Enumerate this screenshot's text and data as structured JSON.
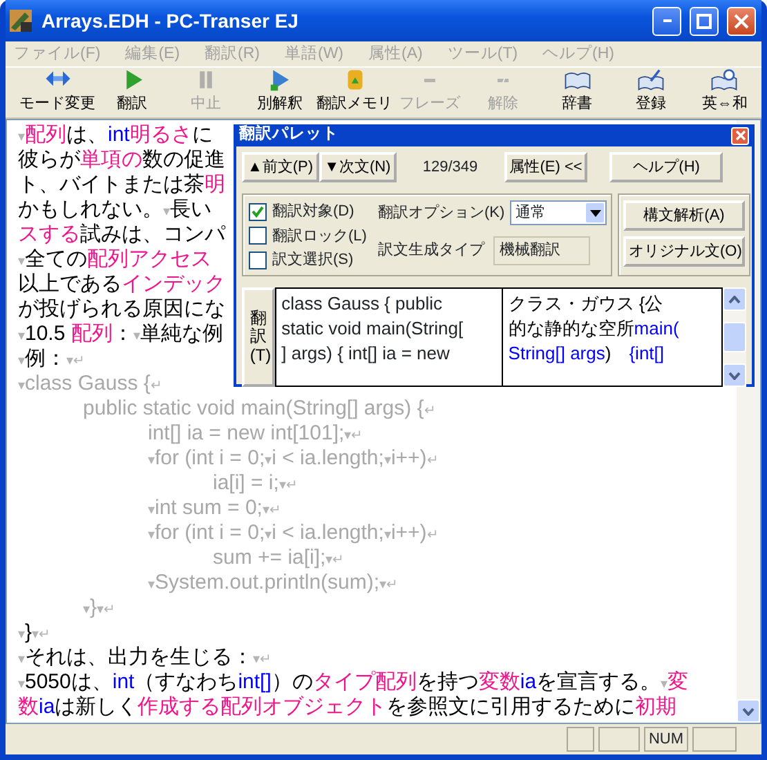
{
  "window": {
    "title": "Arrays.EDH - PC-Transer EJ"
  },
  "menu": [
    "ファイル(F)",
    "編集(E)",
    "翻訳(R)",
    "単語(W)",
    "属性(A)",
    "ツール(T)",
    "ヘルプ(H)"
  ],
  "toolbar": [
    {
      "label": "モード変更",
      "disabled": false
    },
    {
      "label": "翻訳",
      "disabled": false
    },
    {
      "label": "中止",
      "disabled": true
    },
    {
      "label": "別解釈",
      "disabled": false
    },
    {
      "label": "翻訳メモリ",
      "disabled": false
    },
    {
      "label": "フレーズ",
      "disabled": true
    },
    {
      "label": "解除",
      "disabled": true
    },
    {
      "label": "辞書",
      "disabled": false
    },
    {
      "label": "登録",
      "disabled": false
    },
    {
      "label": "英⇔和",
      "disabled": false
    }
  ],
  "document": [
    [
      {
        "kind": "mark",
        "text": "▾"
      },
      {
        "kind": "term",
        "text": "配列"
      },
      {
        "kind": "plain",
        "text": "は、"
      },
      {
        "kind": "keyword",
        "text": "int"
      },
      {
        "kind": "term",
        "text": "明るさ"
      },
      {
        "kind": "plain",
        "text": "に"
      }
    ],
    [
      {
        "kind": "plain",
        "text": "彼らが"
      },
      {
        "kind": "term",
        "text": "単項の"
      },
      {
        "kind": "plain",
        "text": "数の促進"
      }
    ],
    [
      {
        "kind": "plain",
        "text": "ト、バイトまたは茶"
      },
      {
        "kind": "term",
        "text": "明"
      }
    ],
    [
      {
        "kind": "plain",
        "text": "かもしれない。"
      },
      {
        "kind": "mark",
        "text": "▾"
      },
      {
        "kind": "plain",
        "text": "長い"
      }
    ],
    [
      {
        "kind": "term",
        "text": "スする"
      },
      {
        "kind": "plain",
        "text": "試みは、コンパ"
      }
    ],
    [
      {
        "kind": "mark",
        "text": "▾"
      },
      {
        "kind": "plain",
        "text": "全ての"
      },
      {
        "kind": "term",
        "text": "配列アクセス"
      }
    ],
    [
      {
        "kind": "plain",
        "text": "以上である"
      },
      {
        "kind": "term",
        "text": "インデック"
      }
    ],
    [
      {
        "kind": "plain",
        "text": "が投げられる原因にな"
      }
    ],
    [
      {
        "kind": "mark",
        "text": "▾"
      },
      {
        "kind": "plain",
        "text": "10.5 "
      },
      {
        "kind": "term",
        "text": "配列"
      },
      {
        "kind": "plain",
        "text": "："
      },
      {
        "kind": "mark",
        "text": "▾"
      },
      {
        "kind": "plain",
        "text": "単純な例"
      }
    ],
    [
      {
        "kind": "mark",
        "text": "▾"
      },
      {
        "kind": "plain",
        "text": "例："
      },
      {
        "kind": "mark",
        "text": "▾↵"
      }
    ],
    [
      {
        "kind": "mark",
        "text": "▾"
      },
      {
        "kind": "code",
        "text": "class Gauss {"
      },
      {
        "kind": "mark",
        "text": "↵"
      }
    ],
    [
      {
        "kind": "code",
        "text": "\tpublic static void main(String[] args) {"
      },
      {
        "kind": "mark",
        "text": "↵"
      }
    ],
    [
      {
        "kind": "code",
        "text": "\t\tint[] ia = new int[101];"
      },
      {
        "kind": "mark",
        "text": "▾↵"
      }
    ],
    [
      {
        "kind": "mark",
        "text": "\t\t▾"
      },
      {
        "kind": "code",
        "text": "for (int i = 0;"
      },
      {
        "kind": "mark",
        "text": "▾"
      },
      {
        "kind": "code",
        "text": "i < ia.length;"
      },
      {
        "kind": "mark",
        "text": "▾"
      },
      {
        "kind": "code",
        "text": "i++)"
      },
      {
        "kind": "mark",
        "text": "↵"
      }
    ],
    [
      {
        "kind": "code",
        "text": "\t\t\tia[i] = i;"
      },
      {
        "kind": "mark",
        "text": "▾↵"
      }
    ],
    [
      {
        "kind": "mark",
        "text": "\t\t▾"
      },
      {
        "kind": "code",
        "text": "int sum = 0;"
      },
      {
        "kind": "mark",
        "text": "▾↵"
      }
    ],
    [
      {
        "kind": "mark",
        "text": "\t\t▾"
      },
      {
        "kind": "code",
        "text": "for (int i = 0;"
      },
      {
        "kind": "mark",
        "text": "▾"
      },
      {
        "kind": "code",
        "text": "i < ia.length;"
      },
      {
        "kind": "mark",
        "text": "▾"
      },
      {
        "kind": "code",
        "text": "i++)"
      },
      {
        "kind": "mark",
        "text": "↵"
      }
    ],
    [
      {
        "kind": "code",
        "text": "\t\t\tsum += ia[i];"
      },
      {
        "kind": "mark",
        "text": "▾↵"
      }
    ],
    [
      {
        "kind": "mark",
        "text": "\t\t▾"
      },
      {
        "kind": "code",
        "text": "System.out.println(sum);"
      },
      {
        "kind": "mark",
        "text": "▾↵"
      }
    ],
    [
      {
        "kind": "mark",
        "text": "\t▾"
      },
      {
        "kind": "code",
        "text": "}"
      },
      {
        "kind": "mark",
        "text": "▾↵"
      }
    ],
    [
      {
        "kind": "mark",
        "text": "▾"
      },
      {
        "kind": "plain",
        "text": "}"
      },
      {
        "kind": "mark",
        "text": "▾↵"
      }
    ],
    [
      {
        "kind": "mark",
        "text": "▾"
      },
      {
        "kind": "plain",
        "text": "それは、出力を生じる："
      },
      {
        "kind": "mark",
        "text": "▾↵"
      }
    ],
    [
      {
        "kind": "mark",
        "text": "▾"
      },
      {
        "kind": "plain",
        "text": "5050は、"
      },
      {
        "kind": "keyword",
        "text": "int"
      },
      {
        "kind": "plain",
        "text": "（すなわち"
      },
      {
        "kind": "keyword",
        "text": "int[]"
      },
      {
        "kind": "plain",
        "text": "）の"
      },
      {
        "kind": "term",
        "text": "タイプ配列"
      },
      {
        "kind": "plain",
        "text": "を持つ"
      },
      {
        "kind": "term",
        "text": "変数"
      },
      {
        "kind": "keyword",
        "text": "ia"
      },
      {
        "kind": "plain",
        "text": "を宣言する。"
      },
      {
        "kind": "mark",
        "text": "▾"
      },
      {
        "kind": "term",
        "text": "変"
      }
    ],
    [
      {
        "kind": "term",
        "text": "数"
      },
      {
        "kind": "keyword",
        "text": "ia"
      },
      {
        "kind": "plain",
        "text": "は新しく"
      },
      {
        "kind": "term",
        "text": "作成する配列オブジェクト"
      },
      {
        "kind": "plain",
        "text": "を参照文に引用するために"
      },
      {
        "kind": "term",
        "text": "初期"
      }
    ]
  ],
  "palette": {
    "title": "翻訳パレット",
    "prev": "▲前文(P)",
    "next": "▼次文(N)",
    "counter": "129/349",
    "attributes": "属性(E) <<",
    "help": "ヘルプ(H)",
    "checks": [
      {
        "label": "翻訳対象(D)",
        "checked": true
      },
      {
        "label": "翻訳ロック(L)",
        "checked": false
      },
      {
        "label": "訳文選択(S)",
        "checked": false
      }
    ],
    "option_label": "翻訳オプション(K)",
    "option_value": "通常",
    "type_label": "訳文生成タイプ",
    "type_value": "機械翻訳",
    "parse": "構文解析(A)",
    "original": "オリジナル文(O)",
    "translate": "翻訳(T)",
    "source": [
      "class Gauss { public",
      "static void main(String[",
      "] args) { int[] ia = new"
    ],
    "target": [
      [
        {
          "kind": "plain",
          "text": "クラス・ガウス {公"
        }
      ],
      [
        {
          "kind": "plain",
          "text": "的な静的な空所"
        },
        {
          "kind": "keyword",
          "text": "main("
        }
      ],
      [
        {
          "kind": "keyword",
          "text": "String[] args"
        },
        {
          "kind": "plain",
          "text": ")　"
        },
        {
          "kind": "keyword",
          "text": "{int[]"
        }
      ]
    ]
  },
  "status_bar": [
    "NUM"
  ]
}
